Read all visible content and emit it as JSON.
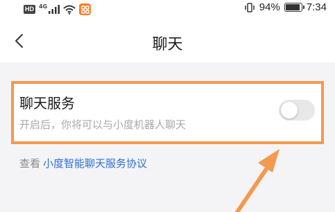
{
  "status_bar": {
    "hd": "HD",
    "network": "4G",
    "battery": "94%",
    "battery_level": 0.94,
    "time": "7:34",
    "icons": [
      "hd-icon",
      "signal-icon",
      "wifi-icon",
      "app-notification-icon",
      "vibrate-icon",
      "battery-icon"
    ]
  },
  "header": {
    "back_icon": "chevron-left-icon",
    "title": "聊天"
  },
  "setting": {
    "title": "聊天服务",
    "description": "开启后，你将可以与小度机器人聊天",
    "toggle_on": false
  },
  "agreement": {
    "prefix": "查看",
    "link": "小度智能聊天服务协议"
  },
  "annotation": {
    "color": "#f39a4e"
  },
  "colors": {
    "background": "#f4f4f6",
    "card": "#ffffff",
    "link": "#2f6fd6",
    "muted": "#a8a8a8"
  }
}
